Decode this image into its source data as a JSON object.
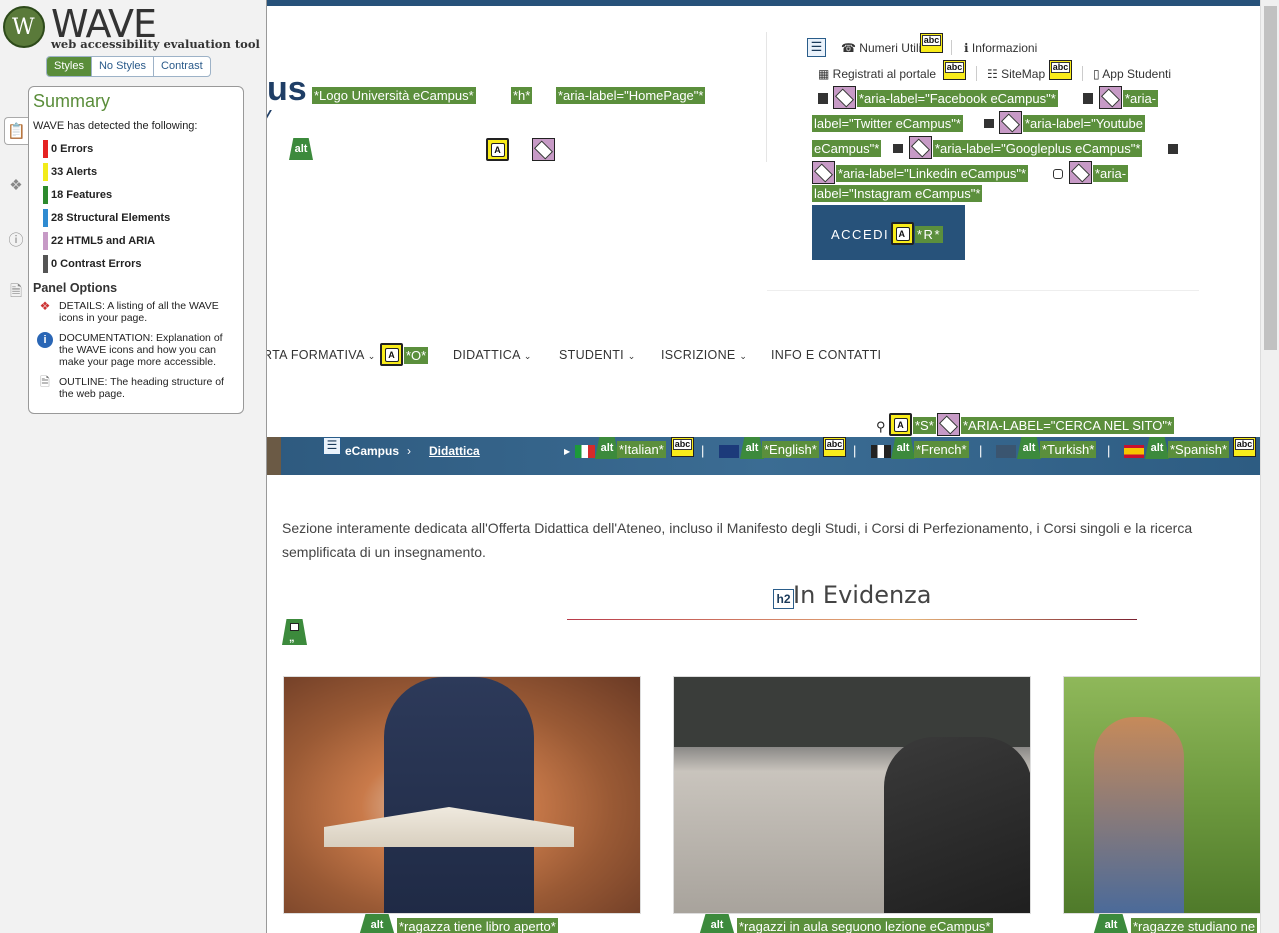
{
  "wave": {
    "logo_word": "WAVE",
    "logo_tagline": "web accessibility evaluation tool",
    "style_buttons": [
      "Styles",
      "No Styles",
      "Contrast"
    ],
    "summary_title": "Summary",
    "summary_intro": "WAVE has detected the following:",
    "categories": [
      {
        "label": "0 Errors",
        "color": "#e52222"
      },
      {
        "label": "33 Alerts",
        "color": "#f2ec1a"
      },
      {
        "label": "18 Features",
        "color": "#2d8a2d"
      },
      {
        "label": "28 Structural Elements",
        "color": "#2f8bd1"
      },
      {
        "label": "22 HTML5 and ARIA",
        "color": "#c79ac6"
      },
      {
        "label": "0 Contrast Errors",
        "color": "#555555"
      }
    ],
    "panel_options_title": "Panel Options",
    "options": [
      {
        "icon": "details-icon",
        "text": "DETAILS: A listing of all the WAVE icons in your page."
      },
      {
        "icon": "documentation-icon",
        "text": "DOCUMENTATION: Explanation of the WAVE icons and how you can make your page more accessible."
      },
      {
        "icon": "outline-icon",
        "text": "OUTLINE: The heading structure of the web page."
      }
    ]
  },
  "site": {
    "logo_partial": "us",
    "logo_labels": [
      "*Logo Università eCampus*",
      "*h*",
      "*aria-label=\"HomePage\"*"
    ],
    "toplinks": {
      "numeri_utili": "Numeri Utili",
      "informazioni": "Informazioni",
      "registrati": "Registrati al portale",
      "sitemap": "SiteMap",
      "app_studenti": "App Studenti"
    },
    "social_labels": [
      "*aria-label=\"Facebook eCampus\"*",
      "*aria-",
      "label=\"Twitter eCampus\"*",
      "*aria-label=\"Youtube",
      "eCampus\"*",
      "*aria-label=\"Googleplus eCampus\"*",
      "*aria-label=\"Linkedin eCampus\"*",
      "*aria-",
      "label=\"Instagram eCampus\"*"
    ],
    "accedi_label": "ACCEDI",
    "accedi_tag": "*R*",
    "nav_items": [
      "RTA FORMATIVA",
      "DIDATTICA",
      "STUDENTI",
      "ISCRIZIONE",
      "INFO E CONTATTI"
    ],
    "nav_tag": "*O*",
    "search_tag_s": "*S*",
    "search_aria": "*ARIA-LABEL=\"CERCA NEL SITO\"*",
    "breadcrumb": [
      "eCampus",
      "Didattica"
    ],
    "languages": [
      "*Italian*",
      "*English*",
      "*French*",
      "*Turkish*",
      "*Spanish*"
    ],
    "description": "Sezione interamente dedicata all'Offerta Didattica dell'Ateneo, incluso il Manifesto degli Studi, i Corsi di Perfezionamento, i Corsi singoli e la ricerca semplificata di un insegnamento.",
    "h2_tag": "h2",
    "section_title": "In Evidenza",
    "cards": [
      {
        "caption": "*ragazza tiene libro aperto*"
      },
      {
        "caption": "*ragazzi in aula seguono lezione eCampus*"
      },
      {
        "caption": "*ragazze studiano ne"
      }
    ],
    "alt_label": "alt",
    "abc_label": "abc",
    "a_label": "A"
  }
}
